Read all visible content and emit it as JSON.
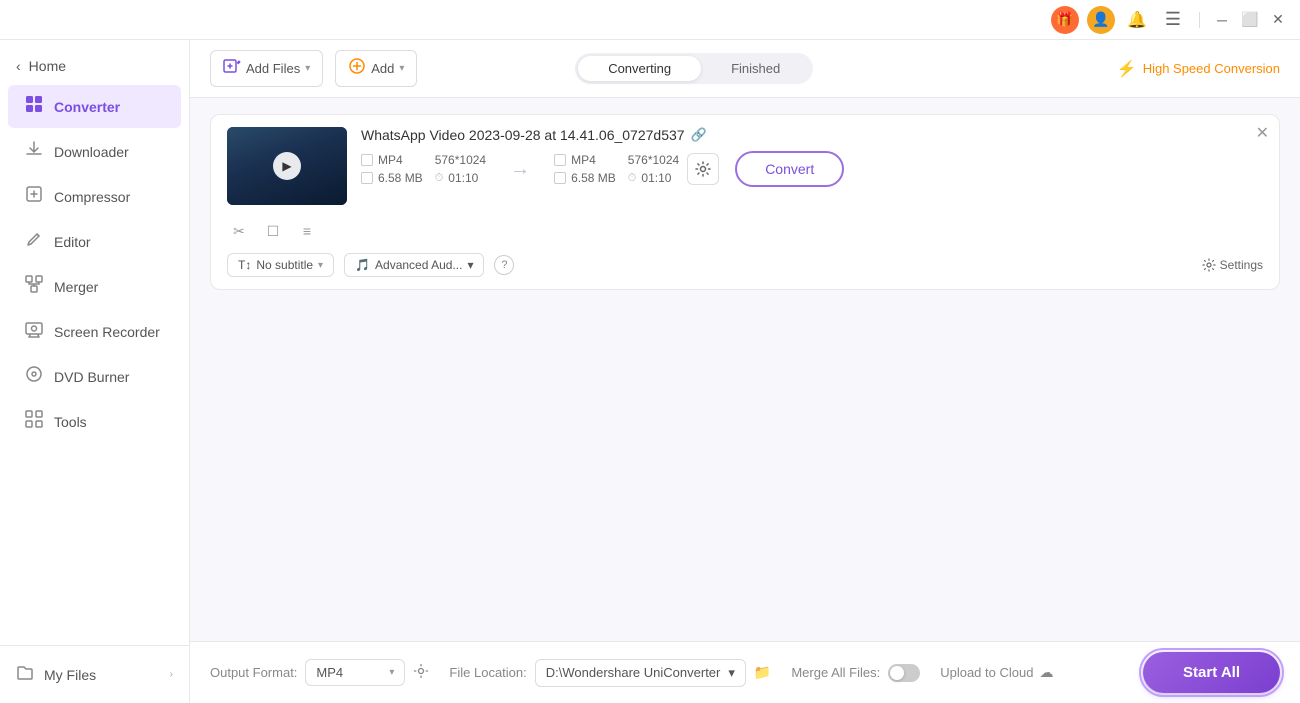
{
  "titlebar": {
    "icons": [
      "gift",
      "user",
      "bell",
      "menu"
    ],
    "window_controls": [
      "minimize",
      "maximize",
      "close"
    ]
  },
  "sidebar": {
    "home_label": "Home",
    "items": [
      {
        "id": "converter",
        "label": "Converter",
        "icon": "⬡",
        "active": true
      },
      {
        "id": "downloader",
        "label": "Downloader",
        "icon": "⬇"
      },
      {
        "id": "compressor",
        "label": "Compressor",
        "icon": "⬡"
      },
      {
        "id": "editor",
        "label": "Editor",
        "icon": "✏"
      },
      {
        "id": "merger",
        "label": "Merger",
        "icon": "⊞"
      },
      {
        "id": "screen-recorder",
        "label": "Screen Recorder",
        "icon": "⬡"
      },
      {
        "id": "dvd-burner",
        "label": "DVD Burner",
        "icon": "⊙"
      },
      {
        "id": "tools",
        "label": "Tools",
        "icon": "⬡"
      }
    ],
    "my_files_label": "My Files"
  },
  "toolbar": {
    "add_files_label": "Add Files",
    "add_label": "Add",
    "tab_converting": "Converting",
    "tab_finished": "Finished",
    "high_speed_label": "High Speed Conversion"
  },
  "file_card": {
    "file_name": "WhatsApp Video 2023-09-28 at 14.41.06_0727d537",
    "source": {
      "format": "MP4",
      "resolution": "576*1024",
      "size": "6.58 MB",
      "duration": "01:10"
    },
    "output": {
      "format": "MP4",
      "resolution": "576*1024",
      "size": "6.58 MB",
      "duration": "01:10"
    },
    "convert_btn": "Convert",
    "no_subtitle": "No subtitle",
    "advanced_audio": "Advanced Aud...",
    "settings_label": "Settings"
  },
  "bottom_bar": {
    "output_format_label": "Output Format:",
    "output_format_value": "MP4",
    "file_location_label": "File Location:",
    "file_location_value": "D:\\Wondershare UniConverter",
    "merge_label": "Merge All Files:",
    "upload_label": "Upload to Cloud",
    "start_all_label": "Start All"
  }
}
